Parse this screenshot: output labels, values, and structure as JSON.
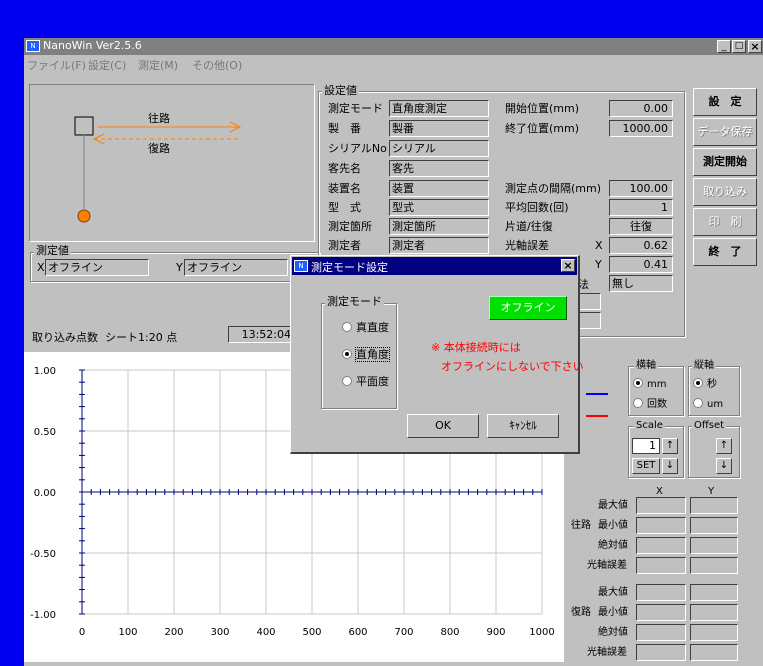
{
  "window": {
    "title": "NanoWin  Ver2.5.6"
  },
  "menu": [
    "ファイル(F)",
    "設定(C)",
    "測定(M)",
    "その他(O)"
  ],
  "diagram": {
    "forward_label": "往路",
    "return_label": "復路"
  },
  "measured": {
    "title": "測定値",
    "x_label": "X",
    "x_value": "オフライン",
    "y_label": "Y",
    "y_value": "オフライン"
  },
  "capture": {
    "label": "取り込み点数",
    "sheet": "シート1:20 点",
    "time": "13:52:04"
  },
  "settings": {
    "title": "設定値",
    "mode_label": "測定モード",
    "mode_value": "直角度測定",
    "serial_label": "製　番",
    "serial_value": "製番",
    "serialno_label": "シリアルNo",
    "serialno_value": "シリアル",
    "customer_label": "客先名",
    "customer_value": "客先",
    "device_label": "装置名",
    "device_value": "装置",
    "model_label": "型　式",
    "model_value": "型式",
    "location_label": "測定箇所",
    "location_value": "測定箇所",
    "operator_label": "測定者",
    "operator_value": "測定者",
    "start_label": "開始位置(mm)",
    "start_value": "0.00",
    "end_label": "終了位置(mm)",
    "end_value": "1000.00",
    "interval_label": "測定点の間隔(mm)",
    "interval_value": "100.00",
    "avg_label": "平均回数(回)",
    "avg_value": "1",
    "direction_label": "片道/往復",
    "direction_value": "往復",
    "axis_err_label": "光軸誤差",
    "axis_x_label": "X",
    "axis_x_value": "0.62",
    "axis_y_label": "Y",
    "axis_y_value": "0.41",
    "partial_label": "法",
    "partial_value": "無し"
  },
  "buttons": {
    "settings": "設　定",
    "save": "データ保存",
    "start": "測定開始",
    "capture": "取り込み",
    "print": "印　刷",
    "exit": "終　了"
  },
  "axes": {
    "h_title": "横軸",
    "h_mm": "mm",
    "h_count": "回数",
    "v_title": "縦軸",
    "v_sec": "秒",
    "v_um": "um",
    "scale_title": "Scale",
    "scale_value": "1",
    "set_label": "SET",
    "offset_title": "Offset",
    "up": "↑",
    "down": "↓"
  },
  "stats": {
    "x_head": "X",
    "y_head": "Y",
    "forward": "往路",
    "return": "復路",
    "max": "最大値",
    "min": "最小値",
    "abs": "絶対値",
    "axis": "光軸誤差"
  },
  "dialog": {
    "title": "測定モード設定",
    "group": "測定モード",
    "opt1": "真直度",
    "opt2": "直角度",
    "opt3": "平面度",
    "offline_button": "オフライン",
    "warn1": "※ 本体接続時には",
    "warn2": "オフラインにしないで下さい",
    "ok": "OK",
    "cancel": "ｷｬﾝｾﾙ"
  },
  "colors": {
    "forward": "#0000ff",
    "return": "#ff0000",
    "offline": "#00e000",
    "warning": "#ff0000",
    "arrow": "#ff8000"
  },
  "chart_data": {
    "type": "scatter",
    "x": [
      0,
      100,
      200,
      300,
      400,
      500,
      600,
      700,
      800,
      900,
      1000
    ],
    "xticks": [
      "0",
      "100",
      "200",
      "300",
      "400",
      "500",
      "600",
      "700",
      "800",
      "900",
      "1000"
    ],
    "yticks": [
      "1.00",
      "0.50",
      "0.00",
      "-0.50",
      "-1.00"
    ],
    "xlim": [
      0,
      1000
    ],
    "ylim": [
      -1,
      1
    ],
    "grid": true,
    "series": []
  }
}
